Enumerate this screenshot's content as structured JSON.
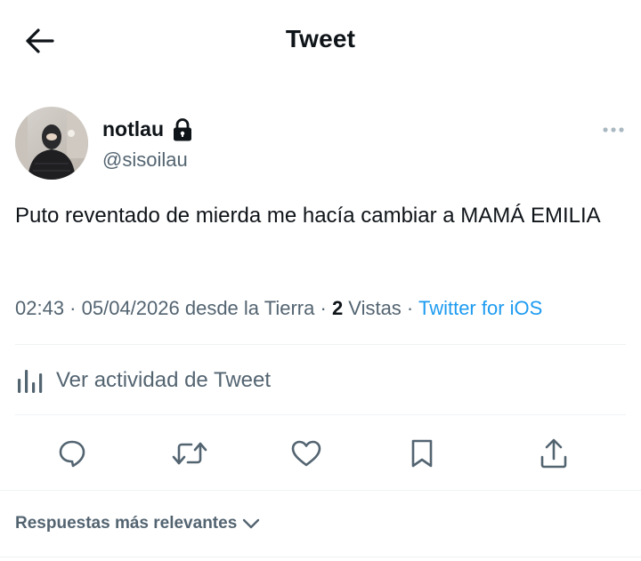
{
  "header": {
    "title": "Tweet",
    "back_icon": "arrow-left-icon"
  },
  "author": {
    "display_name": "notlau",
    "protected_icon": "lock-icon",
    "handle": "@sisoilau",
    "more_icon": "more-horizontal-icon"
  },
  "tweet": {
    "text": "Puto reventado de mierda me hacía cambiar a MAMÁ EMILIA",
    "time": "02:43",
    "separator": " · ",
    "date": "05/04/2026",
    "location": " desde la Tierra",
    "views_count": "2",
    "views_label": " Vistas",
    "source": "Twitter for iOS"
  },
  "activity": {
    "label": "Ver actividad de Tweet",
    "icon": "bar-chart-icon"
  },
  "actions": [
    {
      "name": "reply",
      "icon": "reply-icon"
    },
    {
      "name": "retweet",
      "icon": "retweet-icon"
    },
    {
      "name": "like",
      "icon": "heart-icon"
    },
    {
      "name": "bookmark",
      "icon": "bookmark-icon"
    },
    {
      "name": "share",
      "icon": "share-icon"
    }
  ],
  "replies": {
    "sort_label": "Respuestas más relevantes",
    "sort_icon": "chevron-down-icon"
  },
  "colors": {
    "accent": "#1d9bf0",
    "text_primary": "#0f1419",
    "text_secondary": "#536471",
    "divider": "#eff3f4"
  }
}
